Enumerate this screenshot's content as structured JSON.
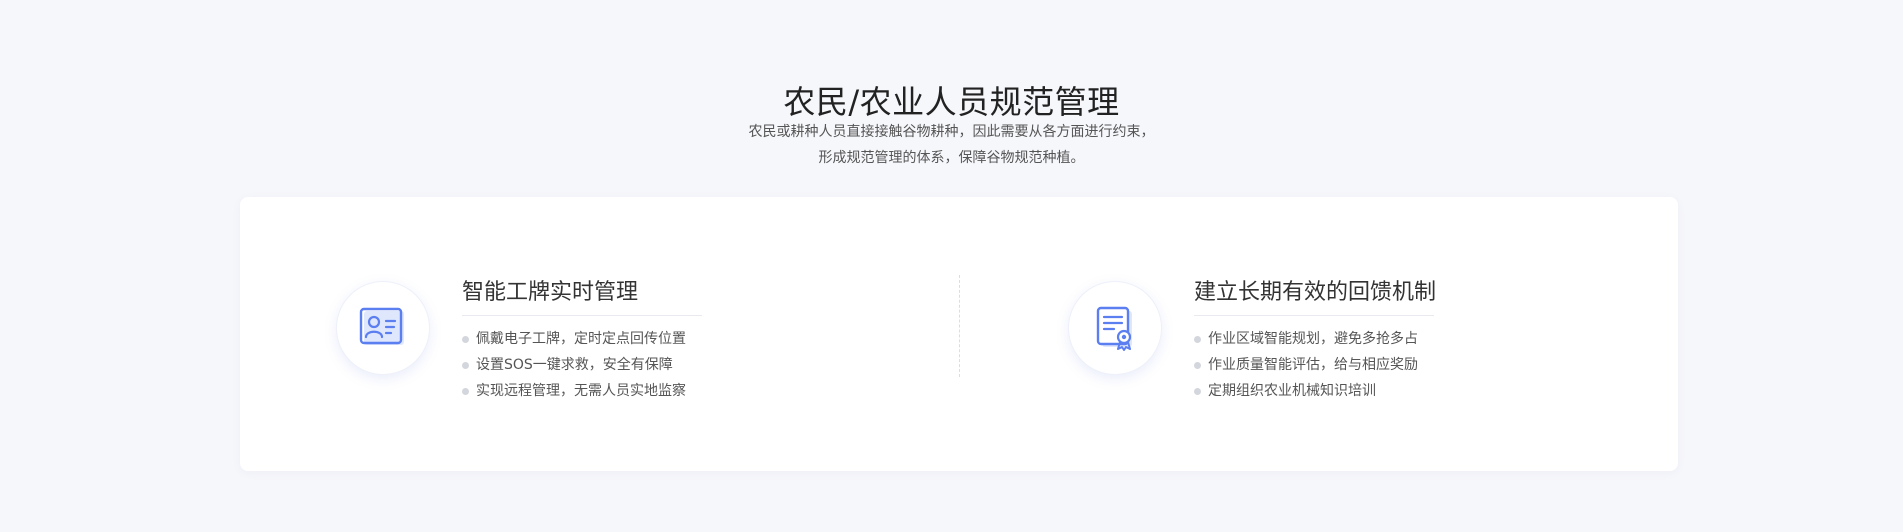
{
  "section": {
    "title": "农民/农业人员规范管理",
    "desc_lines": [
      "农民或耕种人员直接接触谷物耕种，因此需要从各方面进行约束，",
      "形成规范管理的体系，保障谷物规范种植。"
    ]
  },
  "features": [
    {
      "icon": "id-card-icon",
      "title": "智能工牌实时管理",
      "items": [
        "佩戴电子工牌，定时定点回传位置",
        "设置SOS一键求救，安全有保障",
        "实现远程管理，无需人员实地监察"
      ]
    },
    {
      "icon": "certificate-document-icon",
      "title": "建立长期有效的回馈机制",
      "items": [
        "作业区域智能规划，避免多抢多占",
        "作业质量智能评估，给与相应奖励",
        "定期组织农业机械知识培训"
      ]
    }
  ],
  "colors": {
    "accent": "#5b7ef0",
    "background": "#f6f7fb",
    "card": "#ffffff"
  }
}
